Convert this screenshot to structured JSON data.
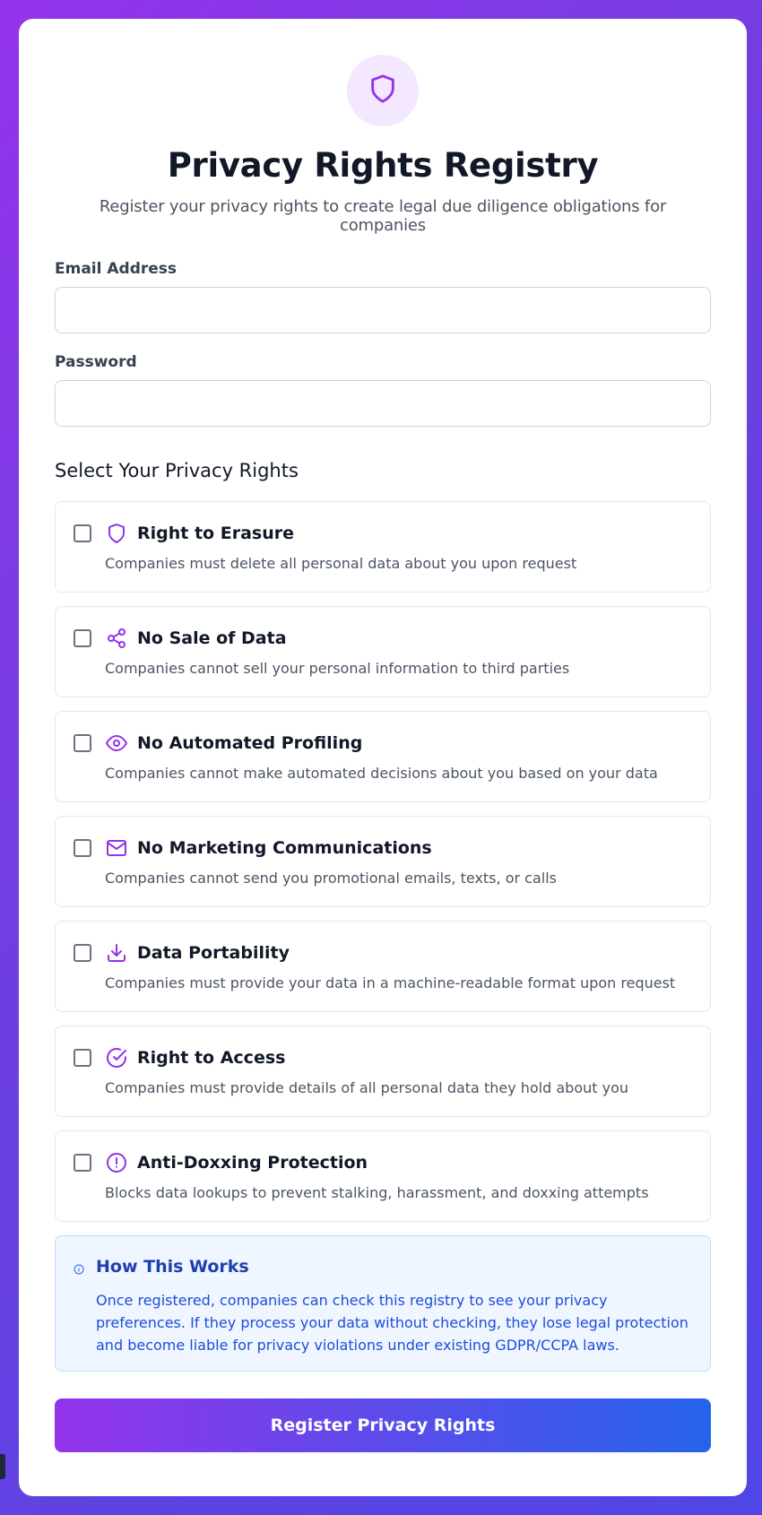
{
  "header": {
    "logo_icon": "shield-icon",
    "title": "Privacy Rights Registry",
    "subtitle": "Register your privacy rights to create legal due diligence obligations for companies"
  },
  "form": {
    "email_label": "Email Address",
    "email_value": "",
    "password_label": "Password",
    "password_value": ""
  },
  "rights_section": {
    "title": "Select Your Privacy Rights",
    "items": [
      {
        "icon": "shield-icon",
        "name": "Right to Erasure",
        "description": "Companies must delete all personal data about you upon request",
        "checked": false
      },
      {
        "icon": "share-icon",
        "name": "No Sale of Data",
        "description": "Companies cannot sell your personal information to third parties",
        "checked": false
      },
      {
        "icon": "eye-icon",
        "name": "No Automated Profiling",
        "description": "Companies cannot make automated decisions about you based on your data",
        "checked": false
      },
      {
        "icon": "mail-icon",
        "name": "No Marketing Communications",
        "description": "Companies cannot send you promotional emails, texts, or calls",
        "checked": false
      },
      {
        "icon": "download-icon",
        "name": "Data Portability",
        "description": "Companies must provide your data in a machine-readable format upon request",
        "checked": false
      },
      {
        "icon": "check-circle-icon",
        "name": "Right to Access",
        "description": "Companies must provide details of all personal data they hold about you",
        "checked": false
      },
      {
        "icon": "alert-circle-icon",
        "name": "Anti-Doxxing Protection",
        "description": "Blocks data lookups to prevent stalking, harassment, and doxxing attempts",
        "checked": false
      }
    ]
  },
  "info": {
    "icon": "info-icon",
    "title": "How This Works",
    "body": "Once registered, companies can check this registry to see your privacy preferences. If they process your data without checking, they lose legal protection and become liable for privacy violations under existing GDPR/CCPA laws."
  },
  "submit_label": "Register Privacy Rights",
  "colors": {
    "accent": "#9333ea",
    "accent_light": "#f3e8ff",
    "info_bg": "#eff6ff",
    "info_text": "#1d4ed8",
    "button_gradient_start": "#9333ea",
    "button_gradient_end": "#2563eb"
  }
}
